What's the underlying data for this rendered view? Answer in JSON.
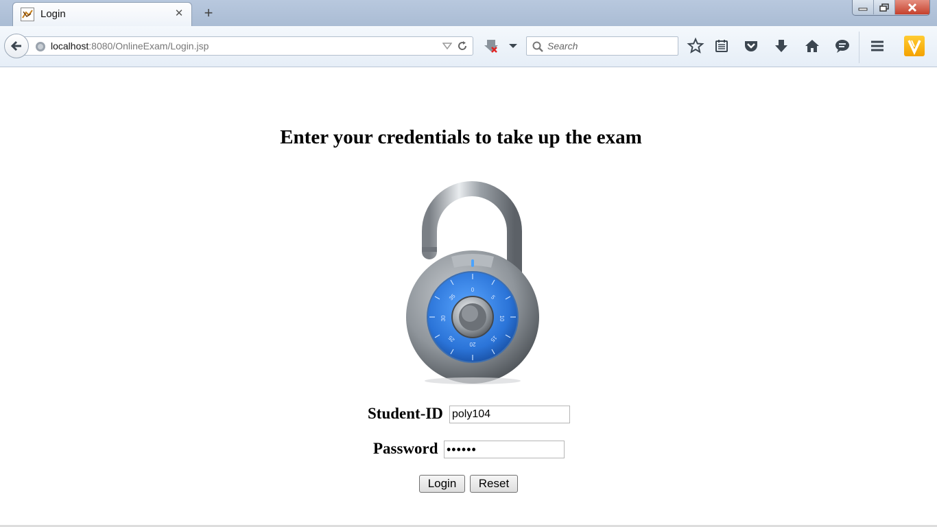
{
  "browser": {
    "tab": {
      "title": "Login"
    },
    "url": {
      "host": "localhost",
      "rest": ":8080/OnlineExam/Login.jsp"
    },
    "search": {
      "placeholder": "Search"
    }
  },
  "page": {
    "heading": "Enter your credentials to take up the exam",
    "student_id_label": "Student-ID",
    "student_id_value": "poly104",
    "password_label": "Password",
    "password_value": "••••••",
    "login_label": "Login",
    "reset_label": "Reset"
  },
  "lock_dial": {
    "numbers": [
      "0",
      "5",
      "10",
      "15",
      "20",
      "25",
      "30",
      "35"
    ]
  },
  "colors": {
    "accent": "#2b74d8",
    "chrome": "#e6eef7"
  }
}
